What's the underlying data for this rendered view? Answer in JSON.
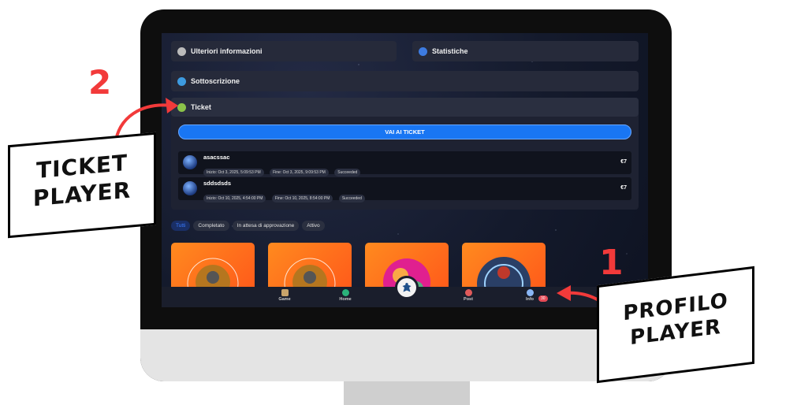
{
  "sections": {
    "info": "Ulteriori informazioni",
    "stats": "Statistiche",
    "subscription": "Sottoscrizione",
    "ticket": "Ticket"
  },
  "ticket_button": "VAI AI TICKET",
  "tickets": [
    {
      "name": "asacssac",
      "start": "Inizio: Oct 3, 2025, 5:09:53 PM",
      "end": "Fine: Oct 3, 2025, 9:09:53 PM",
      "status": "Succeeded",
      "price": "€7"
    },
    {
      "name": "sddsdsds",
      "start": "Inizio: Oct 10, 2025, 4:54:00 PM",
      "end": "Fine: Oct 10, 2025, 8:54:00 PM",
      "status": "Succeeded",
      "price": "€7"
    }
  ],
  "filters": [
    "Tutti",
    "Completato",
    "In attesa di approvazione",
    "Attivo"
  ],
  "nav": {
    "game": "Game",
    "home": "Home",
    "post": "Post",
    "info": "Info",
    "badge": "30"
  },
  "annotations": {
    "num1": "1",
    "num2": "2",
    "ticket_line1": "TICKET",
    "ticket_line2": "PLAYER",
    "profile_line1": "PROFILO",
    "profile_line2": "PLAYER"
  },
  "colors": {
    "accent": "#1976f3",
    "annotation": "#f23a3a",
    "badge": "#e64b57"
  }
}
